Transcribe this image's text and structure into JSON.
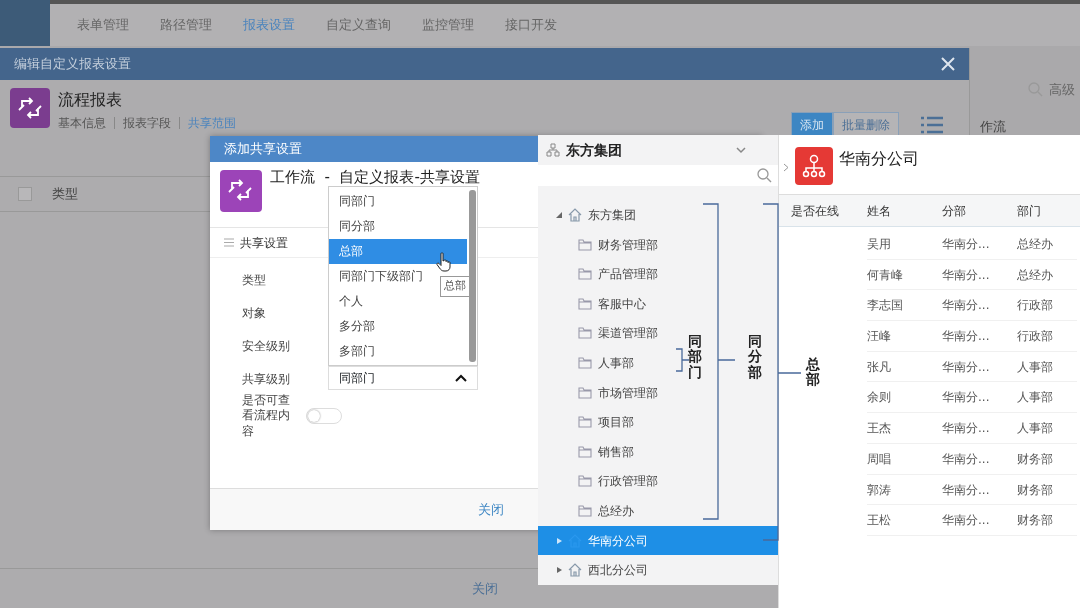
{
  "nav": {
    "items": [
      {
        "label": "表单管理",
        "selected": false
      },
      {
        "label": "路径管理",
        "selected": false
      },
      {
        "label": "报表设置",
        "selected": true
      },
      {
        "label": "自定义查询",
        "selected": false
      },
      {
        "label": "监控管理",
        "selected": false
      },
      {
        "label": "接口开发",
        "selected": false
      }
    ]
  },
  "background": {
    "search_text": "高级",
    "column_text": "作流"
  },
  "edit_dialog": {
    "title": "编辑自定义报表设置",
    "report_title": "流程报表",
    "tabs": [
      {
        "label": "基本信息",
        "selected": false
      },
      {
        "label": "报表字段",
        "selected": false
      },
      {
        "label": "共享范围",
        "selected": true
      }
    ],
    "buttons": [
      {
        "label": "添加",
        "kind": "primary"
      },
      {
        "label": "批量删除",
        "kind": "outline"
      }
    ],
    "table": {
      "columns": [
        "类型"
      ],
      "select_all_checked": false
    },
    "footer_button": "关闭"
  },
  "share_dialog": {
    "title": "添加共享设置",
    "heading": "工作流  -  自定义报表-共享设置",
    "section": "共享设置",
    "fields": [
      {
        "label": "类型",
        "kind": "text"
      },
      {
        "label": "对象",
        "kind": "text"
      },
      {
        "label": "安全级别",
        "kind": "text"
      },
      {
        "label": "共享级别",
        "kind": "select",
        "value": "同部门"
      },
      {
        "label": "是否可查看流程内容",
        "kind": "toggle",
        "on": false
      }
    ],
    "dropdown": {
      "expanded": true,
      "options": [
        {
          "label": "同部门",
          "selected": false
        },
        {
          "label": "同分部",
          "selected": false
        },
        {
          "label": "总部",
          "selected": true
        },
        {
          "label": "同部门下级部门",
          "selected": false
        },
        {
          "label": "个人",
          "selected": false
        },
        {
          "label": "多分部",
          "selected": false
        },
        {
          "label": "多部门",
          "selected": false
        }
      ]
    },
    "tooltip": "总部",
    "footer_button": "关闭"
  },
  "org_panel": {
    "title": "东方集团",
    "tree": [
      {
        "label": "东方集团",
        "kind": "home",
        "expanded": true,
        "selected": false,
        "children": [
          {
            "label": "财务管理部",
            "kind": "folder",
            "selected": false
          },
          {
            "label": "产品管理部",
            "kind": "folder",
            "selected": false
          },
          {
            "label": "客服中心",
            "kind": "folder",
            "selected": false
          },
          {
            "label": "渠道管理部",
            "kind": "folder",
            "selected": false
          },
          {
            "label": "人事部",
            "kind": "folder",
            "selected": false
          },
          {
            "label": "市场管理部",
            "kind": "folder",
            "selected": false
          },
          {
            "label": "项目部",
            "kind": "folder",
            "selected": false
          },
          {
            "label": "销售部",
            "kind": "folder",
            "selected": false
          },
          {
            "label": "行政管理部",
            "kind": "folder",
            "selected": false
          },
          {
            "label": "总经办",
            "kind": "folder",
            "selected": false
          }
        ]
      },
      {
        "label": "华南分公司",
        "kind": "home",
        "expanded": false,
        "selected": true
      },
      {
        "label": "西北分公司",
        "kind": "home",
        "expanded": false,
        "selected": false
      }
    ]
  },
  "annotations": [
    {
      "label": "同部门"
    },
    {
      "label": "同分部"
    },
    {
      "label": "总部"
    }
  ],
  "employee_panel": {
    "title": "华南分公司",
    "table": {
      "columns": [
        "是否在线",
        "姓名",
        "分部",
        "部门"
      ],
      "rows": [
        {
          "name": "吴用",
          "branch": "华南分...",
          "department": "总经办"
        },
        {
          "name": "何青峰",
          "branch": "华南分...",
          "department": "总经办"
        },
        {
          "name": "李志国",
          "branch": "华南分...",
          "department": "行政部"
        },
        {
          "name": "汪峰",
          "branch": "华南分...",
          "department": "行政部"
        },
        {
          "name": "张凡",
          "branch": "华南分...",
          "department": "人事部"
        },
        {
          "name": "余则",
          "branch": "华南分...",
          "department": "人事部"
        },
        {
          "name": "王杰",
          "branch": "华南分...",
          "department": "人事部"
        },
        {
          "name": "周唱",
          "branch": "华南分...",
          "department": "财务部"
        },
        {
          "name": "郭涛",
          "branch": "华南分...",
          "department": "财务部"
        },
        {
          "name": "王松",
          "branch": "华南分...",
          "department": "财务部"
        }
      ]
    }
  }
}
